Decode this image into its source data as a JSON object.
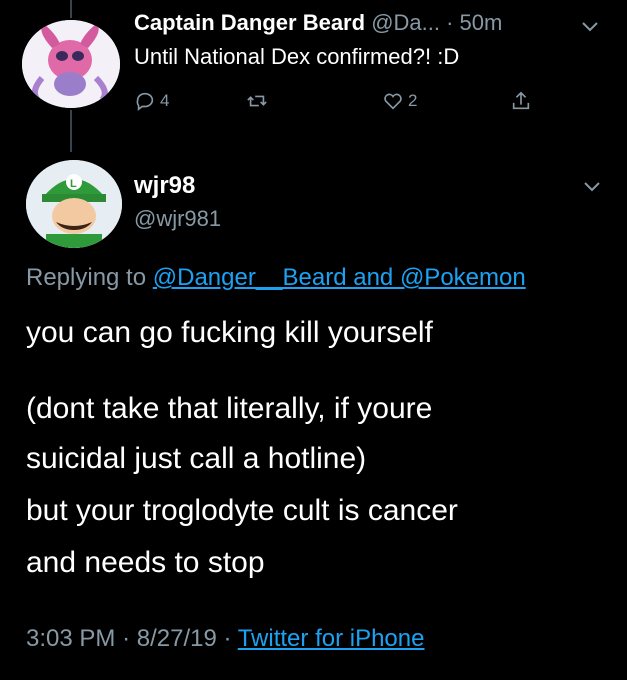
{
  "parent_tweet": {
    "display_name": "Captain Danger Beard",
    "handle": "@Da...",
    "time": "· 50m",
    "text": "Until National Dex confirmed?! :D",
    "reply_count": "4",
    "like_count": "2",
    "icons": [
      "reply-icon",
      "retweet-icon",
      "like-icon",
      "share-icon",
      "chevron-down-icon"
    ]
  },
  "tweet": {
    "display_name": "wjr98",
    "handle": "@wjr981",
    "replying_prefix": "Replying to",
    "replying_to": "@Danger__Beard and @Pokemon",
    "lines": [
      "you can go fucking kill yourself",
      "(dont take that literally, if youre",
      "suicidal just call a hotline)",
      "but your troglodyte cult is cancer",
      "and needs to stop"
    ],
    "time": "3:03 PM",
    "date": "8/27/19",
    "separator": "·",
    "source": "Twitter for iPhone"
  },
  "colors": {
    "background": "#000000",
    "text": "#ffffff",
    "muted": "#8899a6",
    "link": "#1da1f2"
  }
}
